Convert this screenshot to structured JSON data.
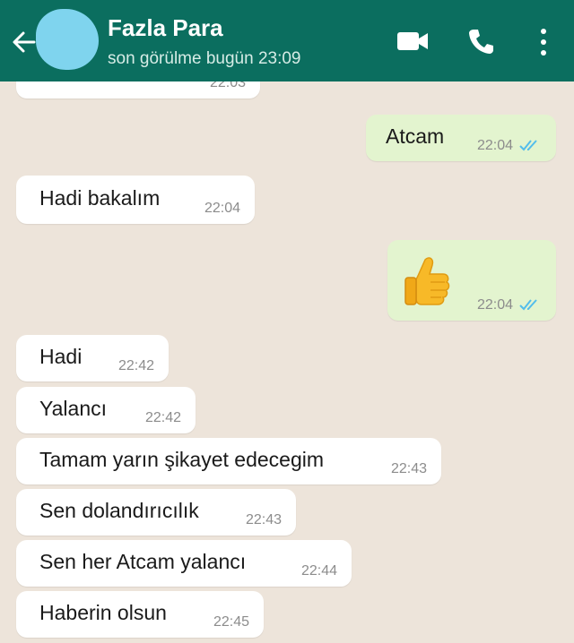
{
  "header": {
    "contact_name": "Fazla Para",
    "last_seen": "son görülme bugün 23:09",
    "icons": [
      "back-arrow-icon",
      "avatar",
      "video-call-icon",
      "voice-call-icon",
      "more-menu-icon"
    ]
  },
  "messages": [
    {
      "dir": "in",
      "text": "",
      "time": "22:03",
      "partial": true
    },
    {
      "dir": "out",
      "text": "Atcam",
      "time": "22:04",
      "read": true
    },
    {
      "dir": "in",
      "text": "Hadi bakalım",
      "time": "22:04"
    },
    {
      "dir": "out",
      "text": "",
      "emoji": "thumbs-up",
      "time": "22:04",
      "read": true
    },
    {
      "dir": "in",
      "text": "Hadi",
      "time": "22:42"
    },
    {
      "dir": "in",
      "text": "Yalancı",
      "time": "22:42"
    },
    {
      "dir": "in",
      "text": "Tamam yarın şikayet edecegim",
      "time": "22:43"
    },
    {
      "dir": "in",
      "text": "Sen dolandırıcılık",
      "time": "22:43"
    },
    {
      "dir": "in",
      "text": "Sen her Atcam yalancı",
      "time": "22:44"
    },
    {
      "dir": "in",
      "text": "Haberin olsun",
      "time": "22:45"
    }
  ],
  "colors": {
    "header_bg": "#0b6e5f",
    "chat_bg": "#ede4da",
    "incoming_bubble": "#ffffff",
    "outgoing_bubble": "#e3f4cf",
    "read_ticks": "#53bdeb"
  }
}
